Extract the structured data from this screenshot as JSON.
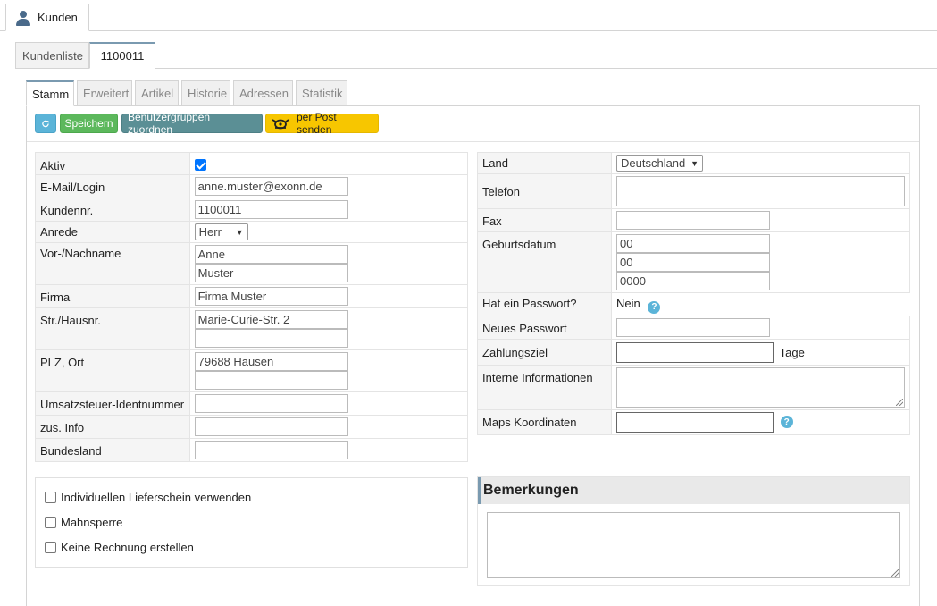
{
  "main_tab": {
    "label": "Kunden",
    "icon": "person-icon"
  },
  "sub_tabs": [
    {
      "label": "Kundenliste"
    },
    {
      "label": "1100011"
    }
  ],
  "inner_tabs": [
    {
      "label": "Stamm"
    },
    {
      "label": "Erweitert"
    },
    {
      "label": "Artikel"
    },
    {
      "label": "Historie"
    },
    {
      "label": "Adressen"
    },
    {
      "label": "Statistik"
    }
  ],
  "toolbar": {
    "refresh_icon": "refresh-icon",
    "save_label": "Speichern",
    "groups_label": "Benutzergruppen zuordnen",
    "post_label": "per Post senden",
    "colors": {
      "refresh": "#5bb4d8",
      "save": "#5cb85c",
      "groups": "#5b8f95",
      "post": "#f7c600"
    }
  },
  "left_form": {
    "aktiv": {
      "label": "Aktiv",
      "checked": true
    },
    "email": {
      "label": "E-Mail/Login",
      "value": "anne.muster@exonn.de"
    },
    "kundennr": {
      "label": "Kundennr.",
      "value": "1100011"
    },
    "anrede": {
      "label": "Anrede",
      "value": "Herr"
    },
    "name": {
      "label": "Vor-/Nachname",
      "first": "Anne",
      "last": "Muster"
    },
    "firma": {
      "label": "Firma",
      "value": "Firma Muster"
    },
    "strasse": {
      "label": "Str./Hausnr.",
      "value": "Marie-Curie-Str. 2",
      "value2": ""
    },
    "plz_ort": {
      "label": "PLZ, Ort",
      "value": "79688 Hausen",
      "value2": ""
    },
    "ust": {
      "label": "Umsatzsteuer-Identnummer",
      "value": ""
    },
    "zus_info": {
      "label": "zus. Info",
      "value": ""
    },
    "bundesland": {
      "label": "Bundesland",
      "value": ""
    }
  },
  "right_form": {
    "land": {
      "label": "Land",
      "value": "Deutschland"
    },
    "telefon": {
      "label": "Telefon",
      "value": ""
    },
    "fax": {
      "label": "Fax",
      "value": ""
    },
    "geburtsdatum": {
      "label": "Geburtsdatum",
      "day": "00",
      "month": "00",
      "year": "0000"
    },
    "passwort": {
      "label": "Hat ein Passwort?",
      "value": "Nein"
    },
    "neues_passwort": {
      "label": "Neues Passwort",
      "value": ""
    },
    "zahlungsziel": {
      "label": "Zahlungsziel",
      "value": "",
      "unit": "Tage"
    },
    "interne_info": {
      "label": "Interne Informationen",
      "value": ""
    },
    "maps": {
      "label": "Maps Koordinaten",
      "value": ""
    }
  },
  "options": [
    {
      "label": "Individuellen Lieferschein verwenden",
      "checked": false
    },
    {
      "label": "Mahnsperre",
      "checked": false
    },
    {
      "label": "Keine Rechnung erstellen",
      "checked": false
    }
  ],
  "remarks": {
    "title": "Bemerkungen",
    "value": ""
  }
}
